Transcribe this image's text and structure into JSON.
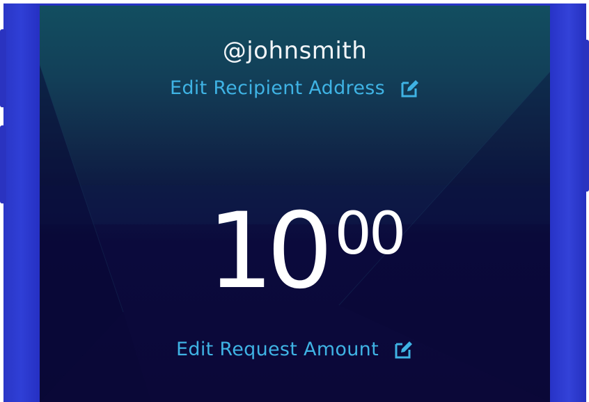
{
  "recipient": {
    "handle": "@johnsmith",
    "edit_label": "Edit Recipient Address",
    "edit_icon": "edit-square-icon"
  },
  "amount": {
    "whole": "10",
    "cents": "00"
  },
  "request": {
    "edit_label": "Edit Request Amount",
    "edit_icon": "edit-square-icon"
  },
  "colors": {
    "accent": "#3fb3e4",
    "frame": "#2a36c6",
    "screen_top": "#124e60",
    "screen_bottom": "#0b0838",
    "text": "#ffffff"
  }
}
